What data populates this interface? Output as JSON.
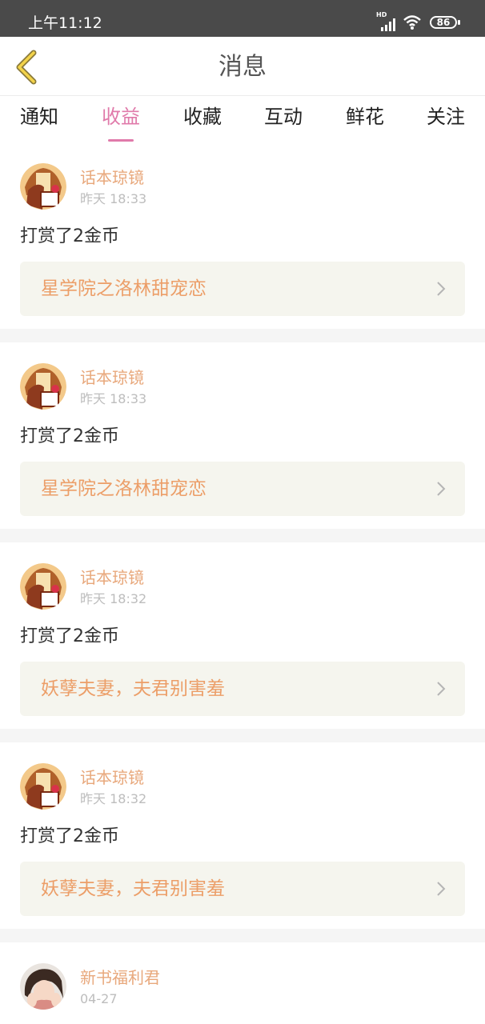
{
  "status_bar": {
    "time": "上午11:12",
    "hd_label": "HD",
    "battery": "86"
  },
  "header": {
    "title": "消息"
  },
  "tabs": [
    {
      "label": "通知",
      "active": false
    },
    {
      "label": "收益",
      "active": true
    },
    {
      "label": "收藏",
      "active": false
    },
    {
      "label": "互动",
      "active": false
    },
    {
      "label": "鲜花",
      "active": false
    },
    {
      "label": "关注",
      "active": false
    }
  ],
  "messages": [
    {
      "sender": "话本琼镜",
      "time": "昨天 18:33",
      "action": "打赏了2金币",
      "book": "星学院之洛林甜宠恋"
    },
    {
      "sender": "话本琼镜",
      "time": "昨天 18:33",
      "action": "打赏了2金币",
      "book": "星学院之洛林甜宠恋"
    },
    {
      "sender": "话本琼镜",
      "time": "昨天 18:32",
      "action": "打赏了2金币",
      "book": "妖孽夫妻，夫君别害羞"
    },
    {
      "sender": "话本琼镜",
      "time": "昨天 18:32",
      "action": "打赏了2金币",
      "book": "妖孽夫妻，夫君别害羞"
    },
    {
      "sender": "新书福利君",
      "time": "04-27"
    }
  ],
  "colors": {
    "accent_pink": "#e07aaa",
    "sender_orange": "#e8a87c",
    "book_title_orange": "#ec9e68",
    "book_card_bg": "#f5f5ee",
    "status_bar_bg": "#4a4a4a"
  }
}
